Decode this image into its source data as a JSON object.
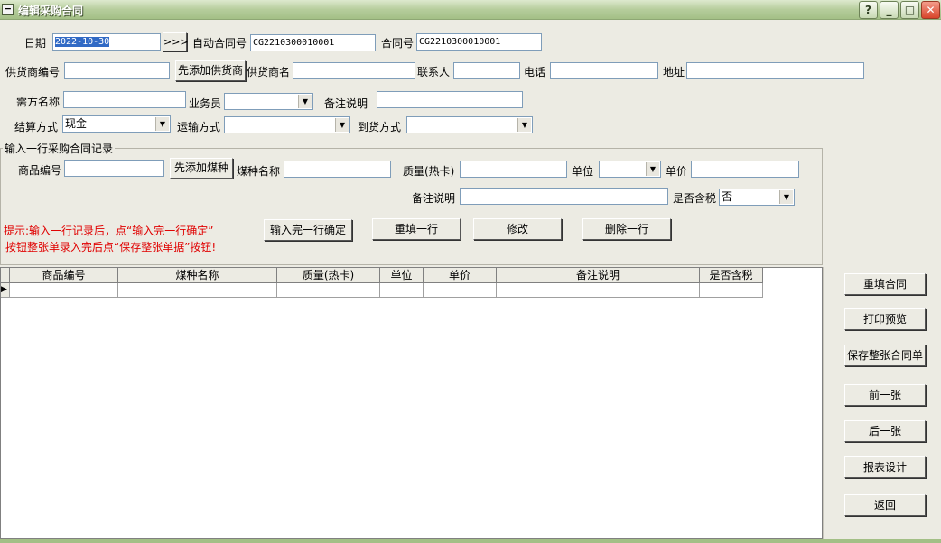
{
  "window": {
    "title": "编辑采购合同",
    "sys_icon": "−",
    "buttons": {
      "help": "?",
      "minimize": "_",
      "maximize": "□",
      "close": "✕"
    }
  },
  "header": {
    "date_label": "日期",
    "date_value": "2022-10-30",
    "date_picker": ">>>",
    "auto_no_label": "自动合同号",
    "auto_no_value": "CG2210300010001",
    "contract_no_label": "合同号",
    "contract_no_value": "CG2210300010001",
    "supplier_no_label": "供货商编号",
    "add_supplier": "先添加供货商",
    "supplier_name_label": "供货商名",
    "contact_label": "联系人",
    "phone_label": "电话",
    "address_label": "地址",
    "buyer_label": "需方名称",
    "salesman_label": "业务员",
    "remark_label": "备注说明",
    "settle_label": "结算方式",
    "settle_value": "现金",
    "transport_label": "运输方式",
    "arrival_label": "到货方式"
  },
  "line_entry": {
    "group_title": "输入一行采购合同记录",
    "product_no_label": "商品编号",
    "add_coal": "先添加煤种",
    "coal_name_label": "煤种名称",
    "quality_label": "质量(热卡)",
    "unit_label": "单位",
    "price_label": "单价",
    "remark_label": "备注说明",
    "tax_label": "是否含税",
    "tax_value": "否",
    "hint_line1": "提示:输入一行记录后，点“输入完一行确定”",
    "hint_line2": "按钮整张单录入完后点“保存整张单据”按钮!",
    "confirm_btn": "输入完一行确定",
    "refill_btn": "重填一行",
    "modify_btn": "修改",
    "delete_btn": "删除一行"
  },
  "grid": {
    "columns": [
      "商品编号",
      "煤种名称",
      "质量(热卡)",
      "单位",
      "单价",
      "备注说明",
      "是否含税"
    ],
    "row_indicator": "▶"
  },
  "side_buttons": {
    "reset": "重填合同",
    "print_preview": "打印预览",
    "save": "保存整张合同单",
    "prev": "前一张",
    "next": "后一张",
    "report_design": "报表设计",
    "back": "返回"
  }
}
